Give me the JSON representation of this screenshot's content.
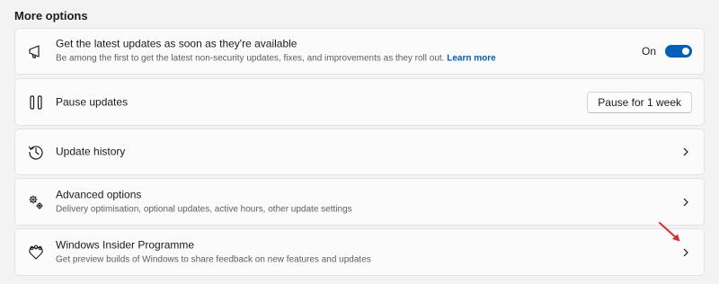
{
  "section_title": "More options",
  "cards": {
    "updates": {
      "title": "Get the latest updates as soon as they're available",
      "subtitle": "Be among the first to get the latest non-security updates, fixes, and improvements as they roll out.",
      "link": "Learn more",
      "toggle_label": "On",
      "toggle_state": true,
      "icon": "megaphone-icon"
    },
    "pause": {
      "title": "Pause updates",
      "button_label": "Pause for 1 week",
      "icon": "pause-icon"
    },
    "history": {
      "title": "Update history",
      "icon": "history-icon"
    },
    "advanced": {
      "title": "Advanced options",
      "subtitle": "Delivery optimisation, optional updates, active hours, other update settings",
      "icon": "gears-icon"
    },
    "insider": {
      "title": "Windows Insider Programme",
      "subtitle": "Get preview builds of Windows to share feedback on new features and updates",
      "icon": "insider-heart-icon"
    }
  },
  "colors": {
    "accent": "#005fb8",
    "annotation_arrow": "#d32f2f",
    "background": "#f3f3f3",
    "card": "#fbfbfb"
  }
}
